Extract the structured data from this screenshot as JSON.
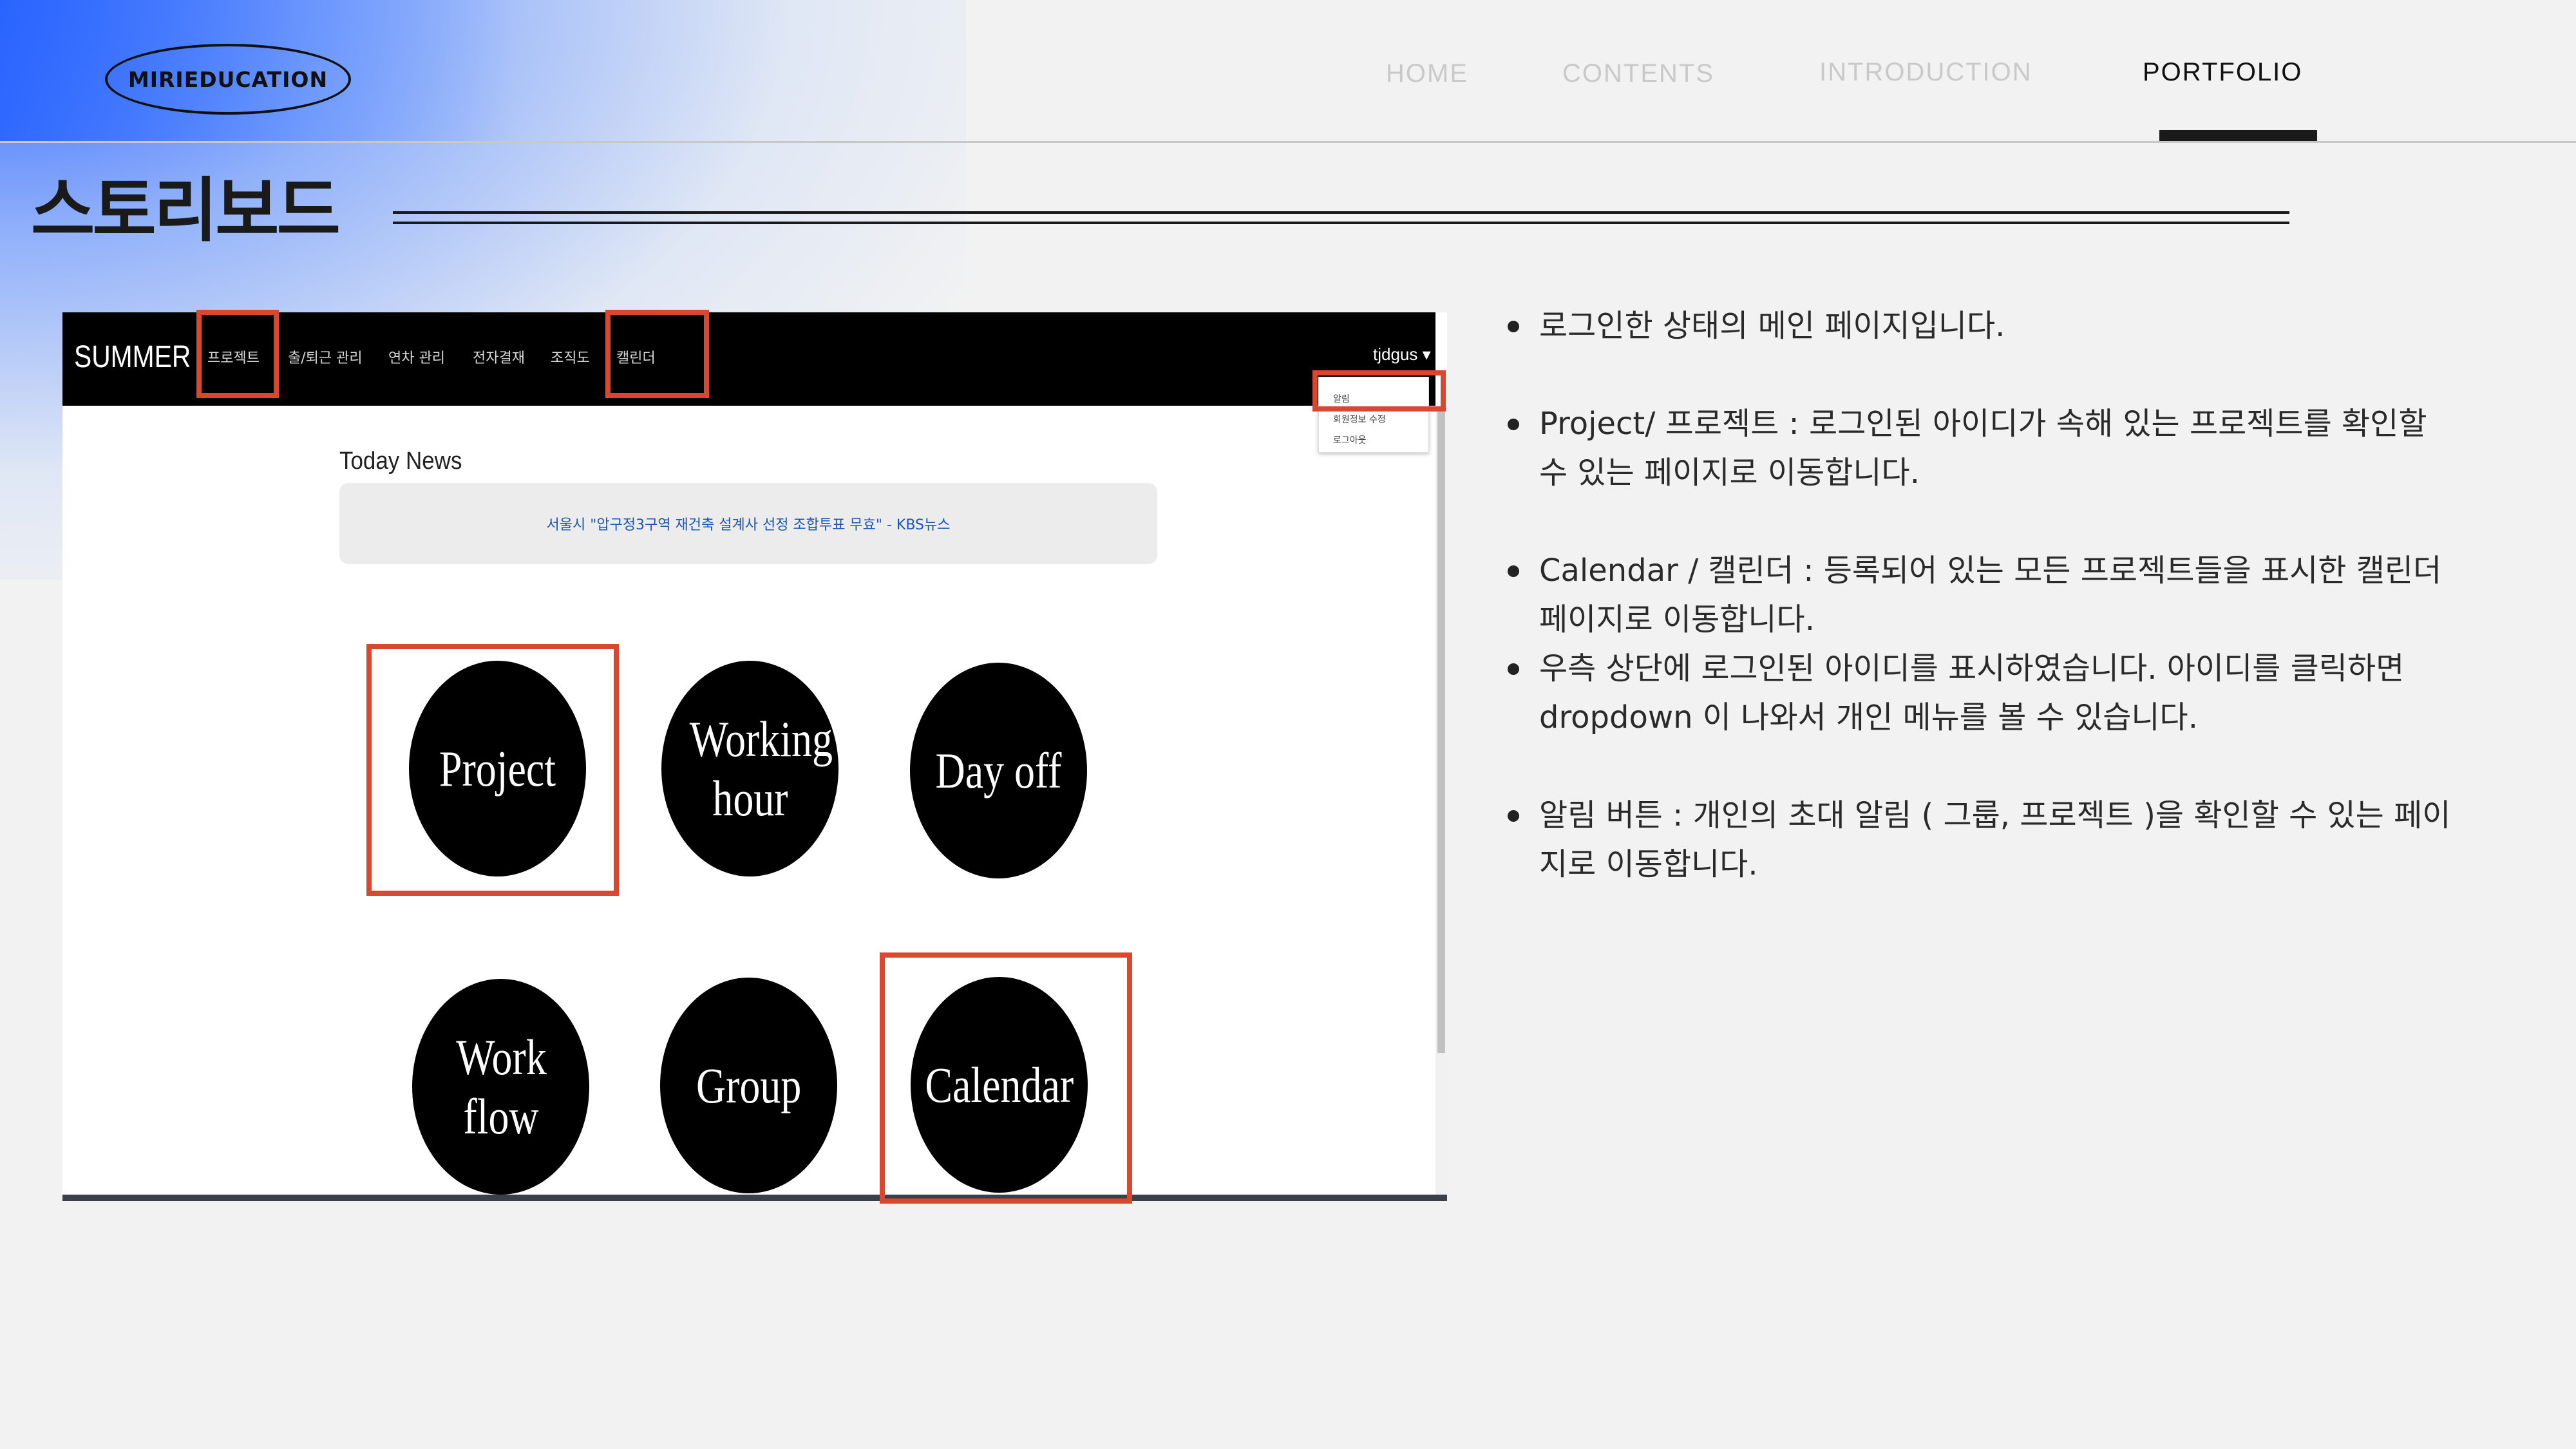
{
  "colors": {
    "accent": "#2a64ff",
    "highlight": "#d8472e",
    "text": "#1a1a1a"
  },
  "header": {
    "logo": "MIRIEDUCATION",
    "nav": [
      {
        "label": "HOME"
      },
      {
        "label": "CONTENTS"
      },
      {
        "label": "INTRODUCTION"
      },
      {
        "label": "PORTFOLIO",
        "active": true
      }
    ]
  },
  "page_title": "스토리보드",
  "screenshot": {
    "brand": "SUMMER",
    "menu": [
      "프로젝트",
      "출/퇴근 관리",
      "연차 관리",
      "전자결재",
      "조직도",
      "캘린더"
    ],
    "user": "tjdgus ▾",
    "dropdown": [
      "알림",
      "회원정보 수정",
      "로그아웃"
    ],
    "news_heading": "Today News",
    "news_link": "서울시 \"압구정3구역 재건축 설계사 선정 조합투표 무효\" - KBS뉴스",
    "circles": [
      {
        "label": "Project"
      },
      {
        "label": "Working hour"
      },
      {
        "label": "Day off"
      },
      {
        "label": "Work flow"
      },
      {
        "label": "Group"
      },
      {
        "label": "Calendar"
      }
    ]
  },
  "bullets": [
    "로그인한 상태의 메인 페이지입니다.",
    "Project/ 프로젝트 : 로그인된 아이디가 속해 있는 프로젝트를 확인할 수 있는 페이지로 이동합니다.",
    "Calendar / 캘린더 : 등록되어 있는 모든 프로젝트들을 표시한 캘린더 페이지로 이동합니다.",
    "우측 상단에 로그인된 아이디를 표시하였습니다. 아이디를 클릭하면 dropdown 이 나와서 개인 메뉴를 볼 수 있습니다.",
    "알림 버튼 : 개인의 초대 알림 ( 그룹, 프로젝트 )을 확인할 수 있는 페이지로 이동합니다."
  ]
}
